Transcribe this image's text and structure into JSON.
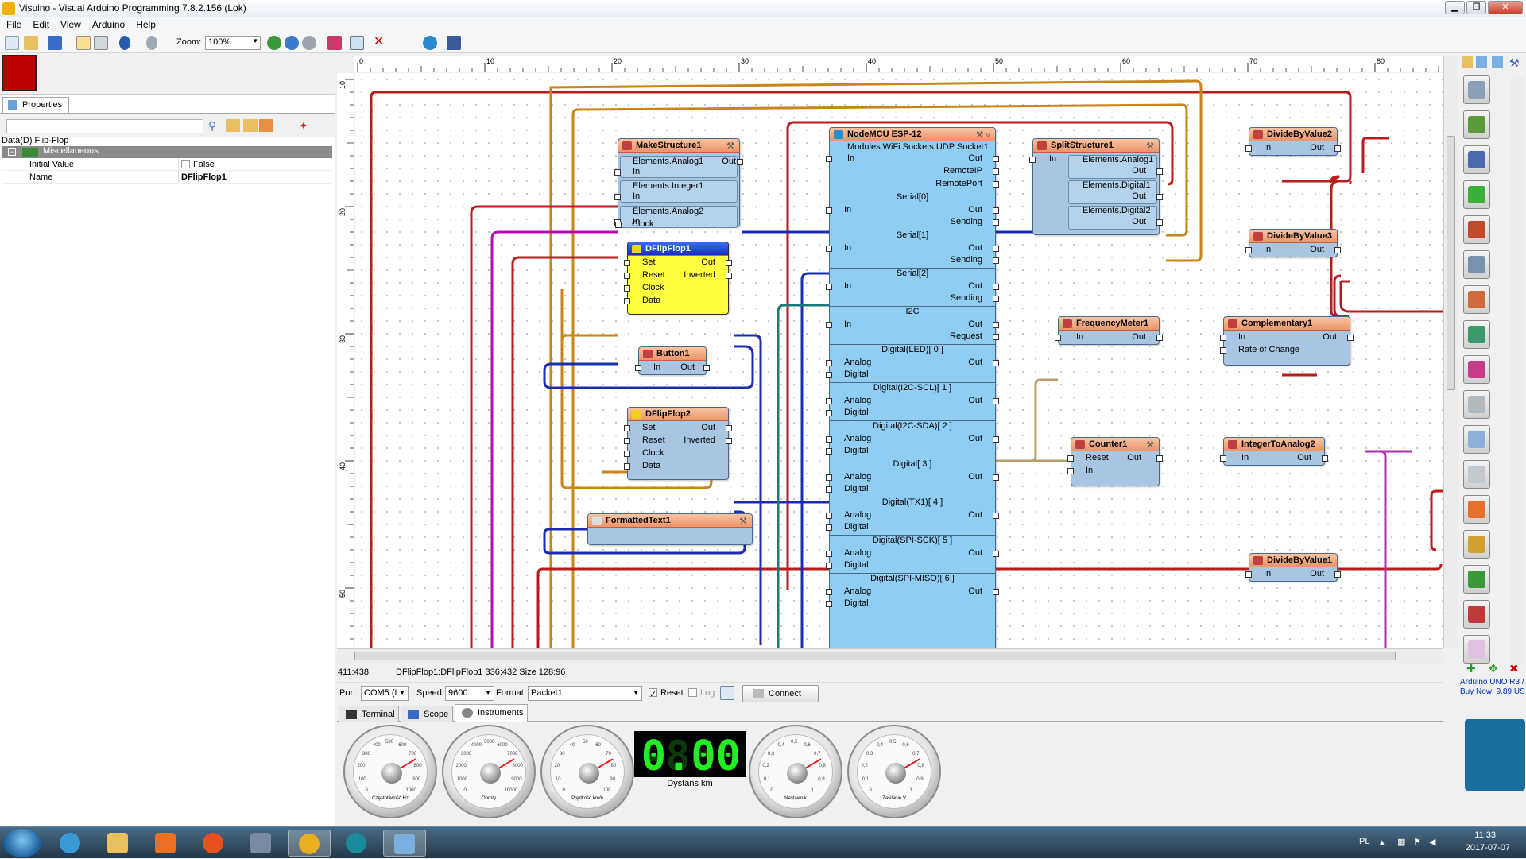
{
  "window": {
    "title": "Visuino - Visual Arduino Programming 7.8.2.156 (Lok)",
    "controls": [
      "▁",
      "❐",
      "✕"
    ]
  },
  "menu": [
    "File",
    "Edit",
    "View",
    "Arduino",
    "Help"
  ],
  "toolbar": {
    "zoom_label": "Zoom:",
    "zoom_value": "100%"
  },
  "properties": {
    "tab_label": "Properties",
    "caption": "Data(D) Flip-Flop",
    "category": "Miscellaneous",
    "rows": [
      {
        "key": "Initial Value",
        "value": "False"
      },
      {
        "key": "Name",
        "value": "DFlipFlop1"
      }
    ]
  },
  "ruler": {
    "h_ticks": [
      "0",
      "10",
      "20",
      "30",
      "40",
      "50",
      "60",
      "70",
      "80"
    ],
    "v_ticks": [
      "10",
      "20",
      "30",
      "40",
      "50"
    ]
  },
  "components": {
    "make_structure": {
      "title": "MakeStructure1",
      "pins": [
        "Elements.Analog1",
        "In",
        "Elements.Integer1",
        "In",
        "Elements.Analog2",
        "In",
        "Clock"
      ],
      "out": "Out"
    },
    "dflipflop1": {
      "title": "DFlipFlop1",
      "ins": [
        "Set",
        "Reset",
        "Clock",
        "Data"
      ],
      "outs": [
        "Out",
        "Inverted"
      ]
    },
    "button1": {
      "title": "Button1",
      "in": "In",
      "out": "Out"
    },
    "dflipflop2": {
      "title": "DFlipFlop2",
      "ins": [
        "Set",
        "Reset",
        "Clock",
        "Data"
      ],
      "outs": [
        "Out",
        "Inverted"
      ]
    },
    "formatted_text": {
      "title": "FormattedText1"
    },
    "nodemcu": {
      "title": "NodeMCU ESP-12",
      "socket": "Modules.WiFi.Sockets.UDP Socket1",
      "socket_in": "In",
      "socket_outs": [
        "Out",
        "RemoteIP",
        "RemotePort"
      ],
      "sections": [
        {
          "name": "Serial[0]",
          "in": "In",
          "outs": [
            "Out",
            "Sending"
          ]
        },
        {
          "name": "Serial[1]",
          "in": "In",
          "outs": [
            "Out",
            "Sending"
          ]
        },
        {
          "name": "Serial[2]",
          "in": "In",
          "outs": [
            "Out",
            "Sending"
          ]
        },
        {
          "name": "I2C",
          "in": "In",
          "outs": [
            "Out",
            "Request"
          ]
        },
        {
          "name": "Digital(LED)[ 0 ]",
          "ins": [
            "Analog",
            "Digital"
          ],
          "out": "Out"
        },
        {
          "name": "Digital(I2C-SCL)[ 1 ]",
          "ins": [
            "Analog",
            "Digital"
          ],
          "out": "Out"
        },
        {
          "name": "Digital(I2C-SDA)[ 2 ]",
          "ins": [
            "Analog",
            "Digital"
          ],
          "out": "Out"
        },
        {
          "name": "Digital[ 3 ]",
          "ins": [
            "Analog",
            "Digital"
          ],
          "out": "Out"
        },
        {
          "name": "Digital(TX1)[ 4 ]",
          "ins": [
            "Analog",
            "Digital"
          ],
          "out": "Out"
        },
        {
          "name": "Digital(SPI-SCK)[ 5 ]",
          "ins": [
            "Analog",
            "Digital"
          ],
          "out": "Out"
        },
        {
          "name": "Digital(SPI-MISO)[ 6 ]",
          "ins": [
            "Analog",
            "Digital"
          ],
          "out": "Out"
        }
      ]
    },
    "split_structure": {
      "title": "SplitStructure1",
      "in": "In",
      "groups": [
        {
          "name": "Elements.Analog1",
          "out": "Out"
        },
        {
          "name": "Elements.Digital1",
          "out": "Out"
        },
        {
          "name": "Elements.Digital2",
          "out": "Out"
        }
      ]
    },
    "divide2": {
      "title": "DivideByValue2",
      "in": "In",
      "out": "Out"
    },
    "divide3": {
      "title": "DivideByValue3",
      "in": "In",
      "out": "Out"
    },
    "divide1": {
      "title": "DivideByValue1",
      "in": "In",
      "out": "Out"
    },
    "freq": {
      "title": "FrequencyMeter1",
      "in": "In",
      "out": "Out"
    },
    "complementary": {
      "title": "Complementary1",
      "ins": [
        "In",
        "Rate of Change"
      ],
      "out": "Out"
    },
    "counter": {
      "title": "Counter1",
      "ins": [
        "Reset",
        "In"
      ],
      "out": "Out"
    },
    "int2analog": {
      "title": "IntegerToAnalog2",
      "in": "In",
      "out": "Out"
    }
  },
  "status": {
    "coords": "411:438",
    "selection": "DFlipFlop1:DFlipFlop1 336:432 Size 128:96"
  },
  "serial": {
    "port_label": "Port:",
    "port_value": "COM5 (L",
    "speed_label": "Speed:",
    "speed_value": "9600",
    "format_label": "Format:",
    "format_value": "Packet1",
    "reset_label": "Reset",
    "log_label": "Log",
    "connect_label": "Connect"
  },
  "serial_tabs": [
    "Terminal",
    "Scope",
    "Instruments"
  ],
  "instruments": {
    "gauges": [
      {
        "label": "Częstotliwość Hz",
        "ticks": [
          "0",
          "100",
          "200",
          "300",
          "400",
          "500",
          "600",
          "700",
          "800",
          "900",
          "1000"
        ],
        "level": 0.72
      },
      {
        "label": "Obroty",
        "ticks": [
          "0",
          "1000",
          "2000",
          "3000",
          "4000",
          "5000",
          "6000",
          "7000",
          "8000",
          "9000",
          "10000"
        ],
        "level": 0.72
      },
      {
        "label": "Prędkość km/h",
        "ticks": [
          "0",
          "10",
          "20",
          "30",
          "40",
          "50",
          "60",
          "70",
          "80",
          "90",
          "100"
        ],
        "level": 0.72
      },
      {
        "label": "Nastawnik",
        "ticks": [
          "0",
          "0,1",
          "0,2",
          "0,3",
          "0,4",
          "0,5",
          "0,6",
          "0,7",
          "0,8",
          "0,9",
          "1"
        ],
        "level": 0.72
      },
      {
        "label": "Zasilanie V",
        "ticks": [
          "0",
          "0,1",
          "0,2",
          "0,3",
          "0,4",
          "0,5",
          "0,6",
          "0,7",
          "0,8",
          "0,9",
          "1"
        ],
        "level": 0.72
      }
    ],
    "display": {
      "ghost": "-88",
      "value": "0.00",
      "label": "Dystans km"
    }
  },
  "palette_ad": {
    "line1": "Arduino UNO R3 /",
    "line2": "Buy Now: 9.89 US"
  },
  "tray": {
    "lang": "PL",
    "time": "11:33",
    "date": "2017-07-07"
  },
  "colors": {
    "wire_red": "#b81c1c",
    "wire_orange": "#c8861a",
    "wire_blue": "#1a2cb0",
    "wire_purple": "#b030b0",
    "wire_teal": "#1a7a7a",
    "wire_tan": "#b8a070"
  }
}
